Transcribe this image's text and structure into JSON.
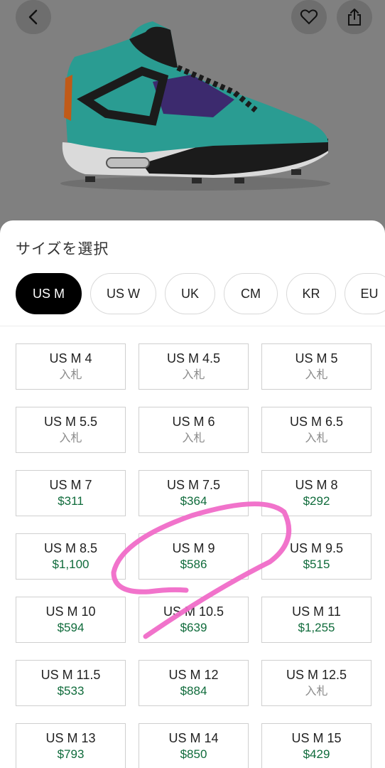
{
  "header": {
    "back_icon": "chevron-left-icon",
    "favorite_icon": "heart-icon",
    "share_icon": "share-icon"
  },
  "product_image": {
    "description_icon": "sneaker-image",
    "colors": {
      "upper": "#2aa096",
      "dark": "#1a1a1a",
      "purple": "#4a2a7a",
      "sole": "#e0e0e0",
      "accent": "#d85a1a"
    }
  },
  "sheet": {
    "title": "サイズを選択",
    "tabs": [
      {
        "label": "US M",
        "active": true
      },
      {
        "label": "US W",
        "active": false
      },
      {
        "label": "UK",
        "active": false
      },
      {
        "label": "CM",
        "active": false
      },
      {
        "label": "KR",
        "active": false
      },
      {
        "label": "EU",
        "active": false
      }
    ],
    "sizes": [
      {
        "size": "US M 4",
        "price": "入札",
        "bid": true
      },
      {
        "size": "US M 4.5",
        "price": "入札",
        "bid": true
      },
      {
        "size": "US M 5",
        "price": "入札",
        "bid": true
      },
      {
        "size": "US M 5.5",
        "price": "入札",
        "bid": true
      },
      {
        "size": "US M 6",
        "price": "入札",
        "bid": true
      },
      {
        "size": "US M 6.5",
        "price": "入札",
        "bid": true
      },
      {
        "size": "US M 7",
        "price": "$311",
        "bid": false
      },
      {
        "size": "US M 7.5",
        "price": "$364",
        "bid": false
      },
      {
        "size": "US M 8",
        "price": "$292",
        "bid": false
      },
      {
        "size": "US M 8.5",
        "price": "$1,100",
        "bid": false
      },
      {
        "size": "US M 9",
        "price": "$586",
        "bid": false
      },
      {
        "size": "US M 9.5",
        "price": "$515",
        "bid": false
      },
      {
        "size": "US M 10",
        "price": "$594",
        "bid": false
      },
      {
        "size": "US M 10.5",
        "price": "$639",
        "bid": false
      },
      {
        "size": "US M 11",
        "price": "$1,255",
        "bid": false
      },
      {
        "size": "US M 11.5",
        "price": "$533",
        "bid": false
      },
      {
        "size": "US M 12",
        "price": "$884",
        "bid": false
      },
      {
        "size": "US M 12.5",
        "price": "入札",
        "bid": true
      },
      {
        "size": "US M 13",
        "price": "$793",
        "bid": false
      },
      {
        "size": "US M 14",
        "price": "$850",
        "bid": false
      },
      {
        "size": "US M 15",
        "price": "$429",
        "bid": false
      }
    ]
  },
  "annotation": {
    "color": "#f06cc8",
    "type": "hand-drawn-circle-around-us-m-9"
  },
  "colors": {
    "price_green": "#0f6b3b",
    "bid_gray": "#8a8a8a",
    "active_tab": "#000000"
  }
}
